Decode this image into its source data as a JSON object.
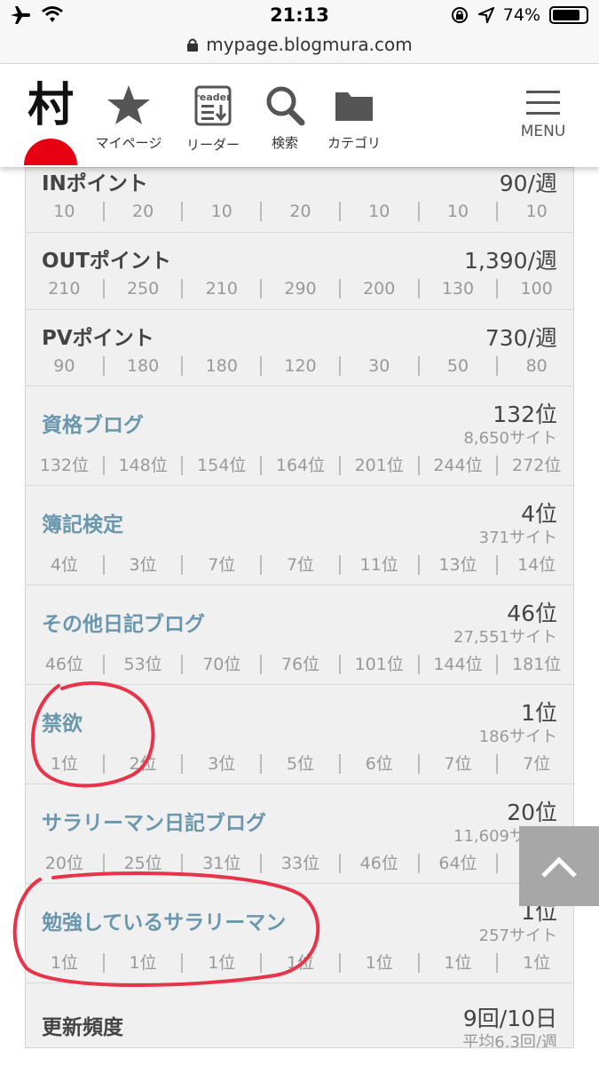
{
  "status_bar": {
    "time": "21:13",
    "battery": "74%"
  },
  "url_bar": {
    "url": "mypage.blogmura.com"
  },
  "header": {
    "logo_text": "村",
    "nav": [
      {
        "label": "マイページ",
        "icon": "star-icon"
      },
      {
        "label": "リーダー",
        "icon": "reader-icon",
        "icon_text": "reader"
      },
      {
        "label": "検索",
        "icon": "search-icon"
      },
      {
        "label": "カテゴリ",
        "icon": "folder-icon"
      }
    ],
    "menu_label": "MENU"
  },
  "stats": [
    {
      "title": "INポイント",
      "value": "90/週",
      "cells": [
        "10",
        "20",
        "10",
        "20",
        "10",
        "10",
        "10"
      ]
    },
    {
      "title": "OUTポイント",
      "value": "1,390/週",
      "cells": [
        "210",
        "250",
        "210",
        "290",
        "200",
        "130",
        "100"
      ]
    },
    {
      "title": "PVポイント",
      "value": "730/週",
      "cells": [
        "90",
        "180",
        "180",
        "120",
        "30",
        "50",
        "80"
      ]
    }
  ],
  "rankings": [
    {
      "title": "資格ブログ",
      "rank": "132位",
      "sites": "8,650サイト",
      "cells": [
        "132位",
        "148位",
        "154位",
        "164位",
        "201位",
        "244位",
        "272位"
      ]
    },
    {
      "title": "簿記検定",
      "rank": "4位",
      "sites": "371サイト",
      "cells": [
        "4位",
        "3位",
        "7位",
        "7位",
        "11位",
        "13位",
        "14位"
      ]
    },
    {
      "title": "その他日記ブログ",
      "rank": "46位",
      "sites": "27,551サイト",
      "cells": [
        "46位",
        "53位",
        "70位",
        "76位",
        "101位",
        "144位",
        "181位"
      ]
    },
    {
      "title": "禁欲",
      "rank": "1位",
      "sites": "186サイト",
      "cells": [
        "1位",
        "2位",
        "3位",
        "5位",
        "6位",
        "7位",
        "7位"
      ]
    },
    {
      "title": "サラリーマン日記ブログ",
      "rank": "20位",
      "sites": "11,609サイト",
      "cells": [
        "20位",
        "25位",
        "31位",
        "33位",
        "46位",
        "64位",
        "8"
      ]
    },
    {
      "title": "勉強しているサラリーマン",
      "rank": "1位",
      "sites": "257サイト",
      "cells": [
        "1位",
        "1位",
        "1位",
        "1位",
        "1位",
        "1位",
        "1位"
      ]
    }
  ],
  "frequency": {
    "title": "更新頻度",
    "value": "9回/10日",
    "sub": "平均6.3回/週"
  },
  "colors": {
    "accent_red": "#e60012",
    "link": "#6a97ad",
    "annotation": "#e8344a"
  }
}
